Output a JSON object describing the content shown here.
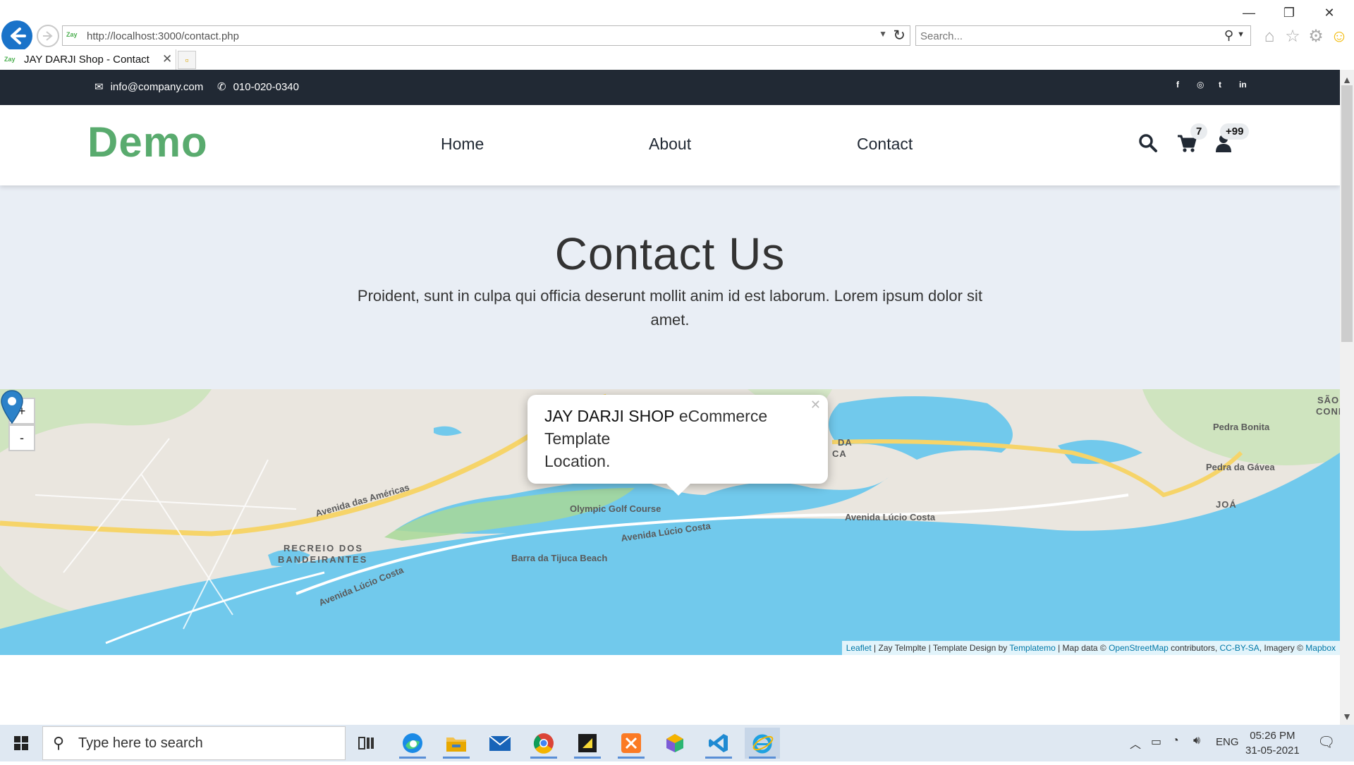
{
  "browser": {
    "url": "http://localhost:3000/contact.php",
    "search_placeholder": "Search...",
    "tab_title": "JAY DARJI Shop - Contact",
    "favicon_text": "Zay"
  },
  "topbar": {
    "email": "info@company.com",
    "phone": "010-020-0340",
    "social": [
      "f",
      "◎",
      "t",
      "in"
    ]
  },
  "navbar": {
    "brand": "Demo",
    "links": [
      "Home",
      "About",
      "Contact"
    ],
    "cart_count": "7",
    "user_count": "+99"
  },
  "hero": {
    "title": "Contact Us",
    "text": "Proident, sunt in culpa qui officia deserunt mollit anim id est laborum. Lorem ipsum dolor sit amet."
  },
  "map": {
    "zoom_in": "+",
    "zoom_out": "-",
    "popup": {
      "bold": "JAY DARJI SHOP",
      "line1_rest": " eCommerce",
      "line2": "Template",
      "line3": "Location."
    },
    "labels": {
      "avenida_americas": "Avenida das Américas",
      "recreio": "RECREIO DOS",
      "bandeirantes": "BANDEIRANTES",
      "avenida_lucio_1": "Avenida Lúcio Costa",
      "avenida_lucio_2": "Avenida Lúcio Costa",
      "avenida_lucio_3": "Avenida Lúcio Costa",
      "olympic_golf": "Olympic Golf Course",
      "barra_beach": "Barra da Tijuca Beach",
      "pedra_bonita": "Pedra Bonita",
      "pedra_gavea": "Pedra da Gávea",
      "joa": "JOÁ",
      "sao_conrado_1": "SÃO",
      "sao_conrado_2": "CONRA",
      "da": "DA",
      "ca": "CA"
    },
    "attribution": {
      "leaflet": "Leaflet",
      "sep1": " | Zay Telmplte | Template Design by ",
      "templatemo": "Templatemo",
      "sep2": " | Map data © ",
      "osm": "OpenStreetMap",
      "sep3": " contributors, ",
      "ccbysa": "CC-BY-SA",
      "sep4": ", Imagery © ",
      "mapbox": "Mapbox"
    }
  },
  "taskbar": {
    "search_placeholder": "Type here to search",
    "lang": "ENG",
    "time": "05:26 PM",
    "date": "31-05-2021"
  },
  "colors": {
    "brand_green": "#59ab6e",
    "topbar_dark": "#212934",
    "hero_bg": "#e9eef5",
    "water": "#71c9ec",
    "road": "#f6d469"
  }
}
